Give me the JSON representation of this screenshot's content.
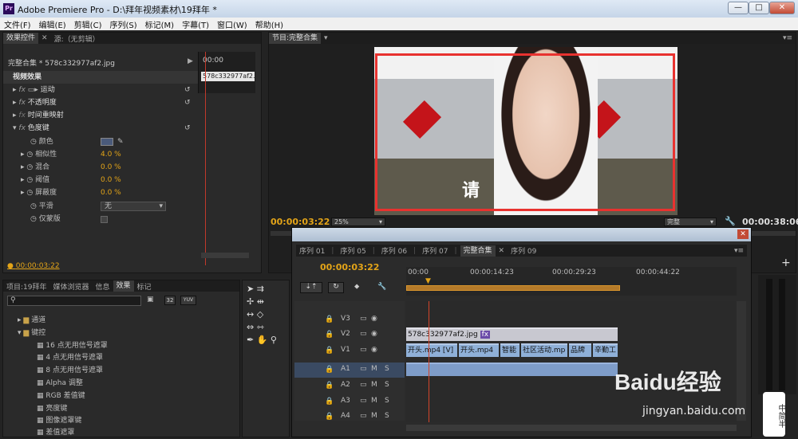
{
  "window": {
    "title": "Adobe Premiere Pro - D:\\拜年视频素材\\19拜年 *",
    "icon": "Pr",
    "min": "—",
    "max": "□",
    "close": "✕"
  },
  "menu": [
    "文件(F)",
    "编辑(E)",
    "剪辑(C)",
    "序列(S)",
    "标记(M)",
    "字幕(T)",
    "窗口(W)",
    "帮助(H)"
  ],
  "effects_panel": {
    "tab1": "效果控件",
    "tab2": "源:（无剪辑）",
    "clip": "完整合集 * 578c332977af2.jpg",
    "timecode_ruler": "00:00",
    "clip_label": "578c332977af2.jpg",
    "section": "视频效果",
    "rows": [
      {
        "fx": "fx",
        "name": "运动"
      },
      {
        "fx": "fx",
        "name": "不透明度"
      },
      {
        "fx": "fx",
        "name": "时间重映射"
      },
      {
        "fx": "fx",
        "name": "色度键"
      }
    ],
    "params": [
      {
        "name": "颜色",
        "value": ""
      },
      {
        "name": "相似性",
        "value": "4.0 %"
      },
      {
        "name": "混合",
        "value": "0.0 %"
      },
      {
        "name": "阈值",
        "value": "0.0 %"
      },
      {
        "name": "屏蔽度",
        "value": "0.0 %"
      },
      {
        "name": "平滑",
        "value": "无"
      },
      {
        "name": "仅蒙版",
        "value": ""
      }
    ],
    "timecode": "00:00:03:22"
  },
  "program": {
    "tab": "节目:完整合集",
    "tc_left": "00:00:03:22",
    "zoom": "25%",
    "quality": "完整",
    "tc_right": "00:00:38:06",
    "overlay_text": "请"
  },
  "project_panel": {
    "tabs": [
      "项目:19拜年",
      "媒体浏览器",
      "信息",
      "效果",
      "标记"
    ],
    "search_placeholder": "",
    "tree": [
      {
        "name": "通道",
        "indent": 1
      },
      {
        "name": "键控",
        "indent": 1,
        "open": true
      },
      {
        "name": "16 点无用信号遮罩",
        "indent": 2
      },
      {
        "name": "4 点无用信号遮罩",
        "indent": 2
      },
      {
        "name": "8 点无用信号遮罩",
        "indent": 2
      },
      {
        "name": "Alpha 调整",
        "indent": 2
      },
      {
        "name": "RGB 差值键",
        "indent": 2
      },
      {
        "name": "亮度键",
        "indent": 2
      },
      {
        "name": "图像遮罩键",
        "indent": 2
      },
      {
        "name": "差值遮罩",
        "indent": 2
      }
    ],
    "badge1": "32",
    "badge2": "YUV"
  },
  "timeline": {
    "tabs": [
      "序列 01",
      "序列 05",
      "序列 06",
      "序列 07",
      "完整合集",
      "序列 09"
    ],
    "timecode": "00:00:03:22",
    "ruler": [
      "00:00",
      "00:00:14:23",
      "00:00:29:23",
      "00:00:44:22"
    ],
    "video_tracks": [
      "V3",
      "V2",
      "V1"
    ],
    "audio_tracks": [
      "A1",
      "A2",
      "A3",
      "A4"
    ],
    "m": "M",
    "s": "S",
    "v2_clip": "578c332977af2.jpg",
    "v2_fx": "fx",
    "v1_clips": [
      "开头.mp4 [V]",
      "开头.mp4",
      "智能",
      "社区活动.mp",
      "品牌",
      "辛勤工"
    ]
  },
  "watermark": {
    "brand": "Baidu经验",
    "url": "jingyan.baidu.com",
    "side": "中简半"
  }
}
